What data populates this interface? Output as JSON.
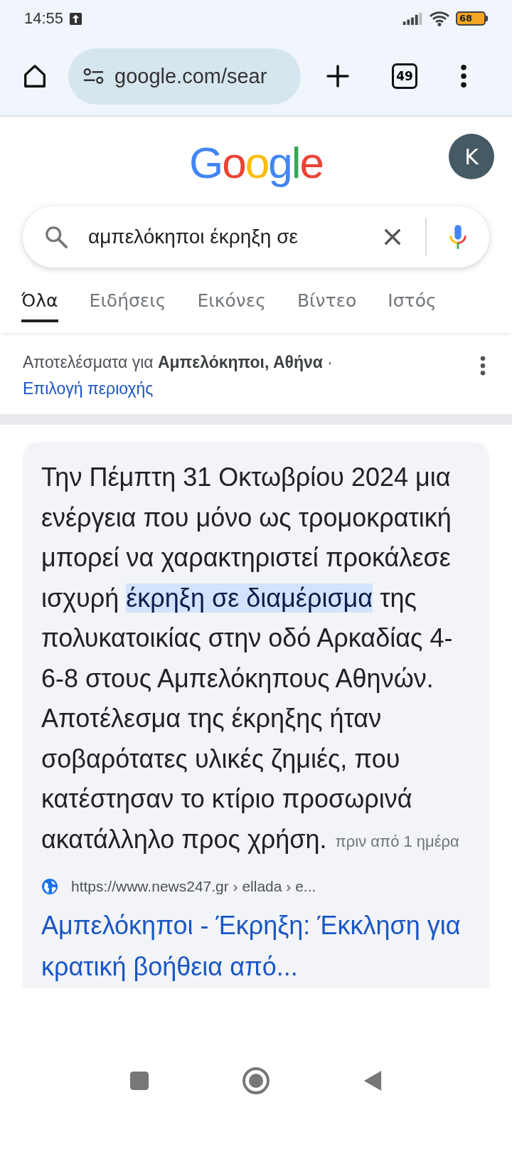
{
  "status_bar": {
    "time": "14:55",
    "battery": "68"
  },
  "browser_toolbar": {
    "address": "google.com/sear",
    "tab_count": "49"
  },
  "header": {
    "logo": "Google",
    "avatar_letter": "K"
  },
  "search": {
    "query": "αμπελόκηποι έκρηξη σε"
  },
  "tabs": [
    {
      "label": "Όλα",
      "selected": true
    },
    {
      "label": "Ειδήσεις",
      "selected": false
    },
    {
      "label": "Εικόνες",
      "selected": false
    },
    {
      "label": "Βίντεο",
      "selected": false
    },
    {
      "label": "Ιστός",
      "selected": false
    }
  ],
  "location": {
    "text": "Αποτελέσματα για **Αμπελόκηποι, Αθήνα** ·",
    "link": "Επιλογή περιοχής"
  },
  "featured_snippet": {
    "text": "Την Πέμπτη 31 Οκτωβρίου 2024 μια ενέργεια που μόνο ως τρομοκρατική μπορεί να χαρακτηριστεί προκάλεσε ισχυρή **έκρηξη σε διαμέρισμα** της πολυκατοικίας στην οδό Αρκαδίας 4-6-8 στους Αμπελόκηπους Αθηνών. Αποτέλεσμα της έκρηξης ήταν σοβαρότατες υλικές ζημιές, που κατέστησαν το κτίριο προσωρινά ακατάλληλο προς χρήση.",
    "date": "πριν από 1 ημέρα",
    "source_url": "https://www.news247.gr › ellada › e...",
    "title": "Αμπελόκηποι - Έκρηξη: Έκκληση για κρατική βοήθεια από..."
  }
}
